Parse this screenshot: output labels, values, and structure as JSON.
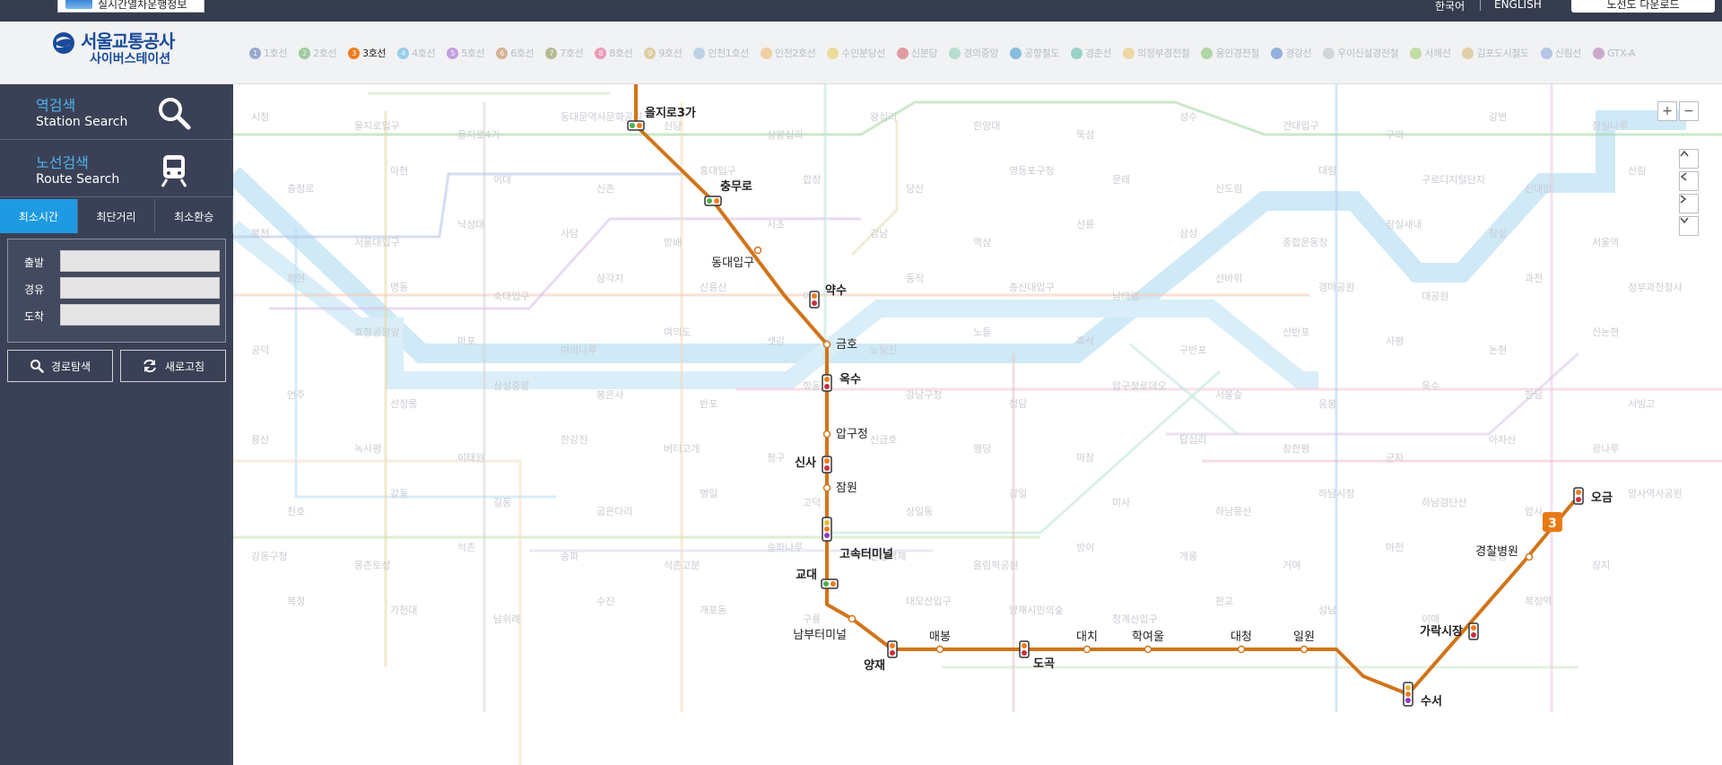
{
  "topbar": {
    "realtime_label": "실시간열차운행정보",
    "lang_ko": "한국어",
    "lang_en": "ENGLISH",
    "download_label": "노선도 다운로드"
  },
  "header": {
    "logo_title": "서울교통공사",
    "logo_subtitle": "사이버스테이션",
    "line_tabs": [
      {
        "num": "1",
        "label": "1호선",
        "color": "#2d53a6",
        "active": false
      },
      {
        "num": "2",
        "label": "2호선",
        "color": "#3a9e3a",
        "active": false
      },
      {
        "num": "3",
        "label": "3호선",
        "color": "#ef7c1c",
        "active": true
      },
      {
        "num": "4",
        "label": "4호선",
        "color": "#2ba3e0",
        "active": false
      },
      {
        "num": "5",
        "label": "5호선",
        "color": "#8a3cc4",
        "active": false
      },
      {
        "num": "6",
        "label": "6호선",
        "color": "#b5681e",
        "active": false
      },
      {
        "num": "7",
        "label": "7호선",
        "color": "#6e7a1e",
        "active": false
      },
      {
        "num": "8",
        "label": "8호선",
        "color": "#e3316f",
        "active": false
      },
      {
        "num": "9",
        "label": "9호선",
        "color": "#c9a43a",
        "active": false
      },
      {
        "num": "",
        "label": "인천1호선",
        "color": "#7ca8d6",
        "active": false
      },
      {
        "num": "",
        "label": "인천2호선",
        "color": "#f3a33b",
        "active": false
      },
      {
        "num": "",
        "label": "수인분당선",
        "color": "#e8bf2d",
        "active": false
      },
      {
        "num": "",
        "label": "신분당",
        "color": "#c9303e",
        "active": false
      },
      {
        "num": "",
        "label": "경의중앙",
        "color": "#6ec3a2",
        "active": false
      },
      {
        "num": "",
        "label": "공항철도",
        "color": "#0a7dc4",
        "active": false
      },
      {
        "num": "",
        "label": "경춘선",
        "color": "#2fae8d",
        "active": false
      },
      {
        "num": "",
        "label": "의정부경전철",
        "color": "#e6b73c",
        "active": false
      },
      {
        "num": "",
        "label": "용인경전철",
        "color": "#5db34a",
        "active": false
      },
      {
        "num": "",
        "label": "경강선",
        "color": "#1e5fbe",
        "active": false
      },
      {
        "num": "",
        "label": "우이신설경전철",
        "color": "#b0b3b8",
        "active": false
      },
      {
        "num": "",
        "label": "서해선",
        "color": "#84c341",
        "active": false
      },
      {
        "num": "",
        "label": "김포도시철도",
        "color": "#caa34a",
        "active": false
      },
      {
        "num": "",
        "label": "신림선",
        "color": "#6b8fd6",
        "active": false
      },
      {
        "num": "",
        "label": "GTX-A",
        "color": "#9b4f93",
        "active": false
      }
    ]
  },
  "sidebar": {
    "station_search_ko": "역검색",
    "station_search_en": "Station Search",
    "route_search_ko": "노선검색",
    "route_search_en": "Route Search",
    "tabs": [
      "최소시간",
      "최단거리",
      "최소환승"
    ],
    "form": {
      "departure": "출발",
      "via": "경유",
      "arrival": "도착"
    },
    "search_button": "경로탐색",
    "refresh_button": "새로고침"
  },
  "map": {
    "controls": {
      "zoom_in": "+",
      "zoom_out": "−"
    },
    "line3_color": "#d27418",
    "line_badge": "3",
    "line3_stations": [
      "을지로3가",
      "충무로",
      "동대입구",
      "약수",
      "금호",
      "옥수",
      "압구정",
      "신사",
      "잠원",
      "고속터미널",
      "교대",
      "남부터미널",
      "양재",
      "매봉",
      "도곡",
      "대치",
      "학여울",
      "대청",
      "일원",
      "수서",
      "가락시장",
      "경찰병원",
      "오금"
    ],
    "background_stations": [
      "시청",
      "을지로입구",
      "을지로4가",
      "동대문역사문화공원",
      "신당",
      "상왕십리",
      "왕십리",
      "한양대",
      "뚝섬",
      "성수",
      "건대입구",
      "구의",
      "강변",
      "잠실나루",
      "충정로",
      "아현",
      "이대",
      "신촌",
      "홍대입구",
      "합정",
      "당산",
      "영등포구청",
      "문래",
      "신도림",
      "대림",
      "구로디지털단지",
      "신대방",
      "신림",
      "봉천",
      "서울대입구",
      "낙성대",
      "사당",
      "방배",
      "서초",
      "강남",
      "역삼",
      "선릉",
      "삼성",
      "종합운동장",
      "잠실새내",
      "잠실",
      "서울역",
      "회현",
      "명동",
      "숙대입구",
      "삼각지",
      "신용산",
      "이촌",
      "동작",
      "총신대입구",
      "남태령",
      "선바위",
      "경마공원",
      "대공원",
      "과천",
      "정부과천청사",
      "공덕",
      "효창공원앞",
      "마포",
      "여의나루",
      "여의도",
      "샛강",
      "노량진",
      "노들",
      "흑석",
      "구반포",
      "신반포",
      "사평",
      "논현",
      "신논현",
      "언주",
      "선정릉",
      "삼성중앙",
      "봉은사",
      "반포",
      "학동",
      "강남구청",
      "청담",
      "압구정로데오",
      "서울숲",
      "응봉",
      "옥수",
      "한남",
      "서빙고",
      "용산",
      "녹사평",
      "이태원",
      "한강진",
      "버티고개",
      "청구",
      "신금호",
      "행당",
      "마장",
      "답십리",
      "장한평",
      "군자",
      "아차산",
      "광나루",
      "천호",
      "강동",
      "길동",
      "굽은다리",
      "명일",
      "고덕",
      "상일동",
      "강일",
      "미사",
      "하남풍산",
      "하남시청",
      "하남검단산",
      "암사",
      "암사역사공원",
      "강동구청",
      "몽촌토성",
      "석촌",
      "송파",
      "석촌고분",
      "송파나루",
      "한성백제",
      "올림픽공원",
      "방이",
      "개롱",
      "거여",
      "마천",
      "문정",
      "장지",
      "복정",
      "가천대",
      "남위례",
      "수진",
      "개포동",
      "구룡",
      "대모산입구",
      "양재시민의숲",
      "청계산입구",
      "판교",
      "성남",
      "이매",
      "복정역"
    ]
  }
}
